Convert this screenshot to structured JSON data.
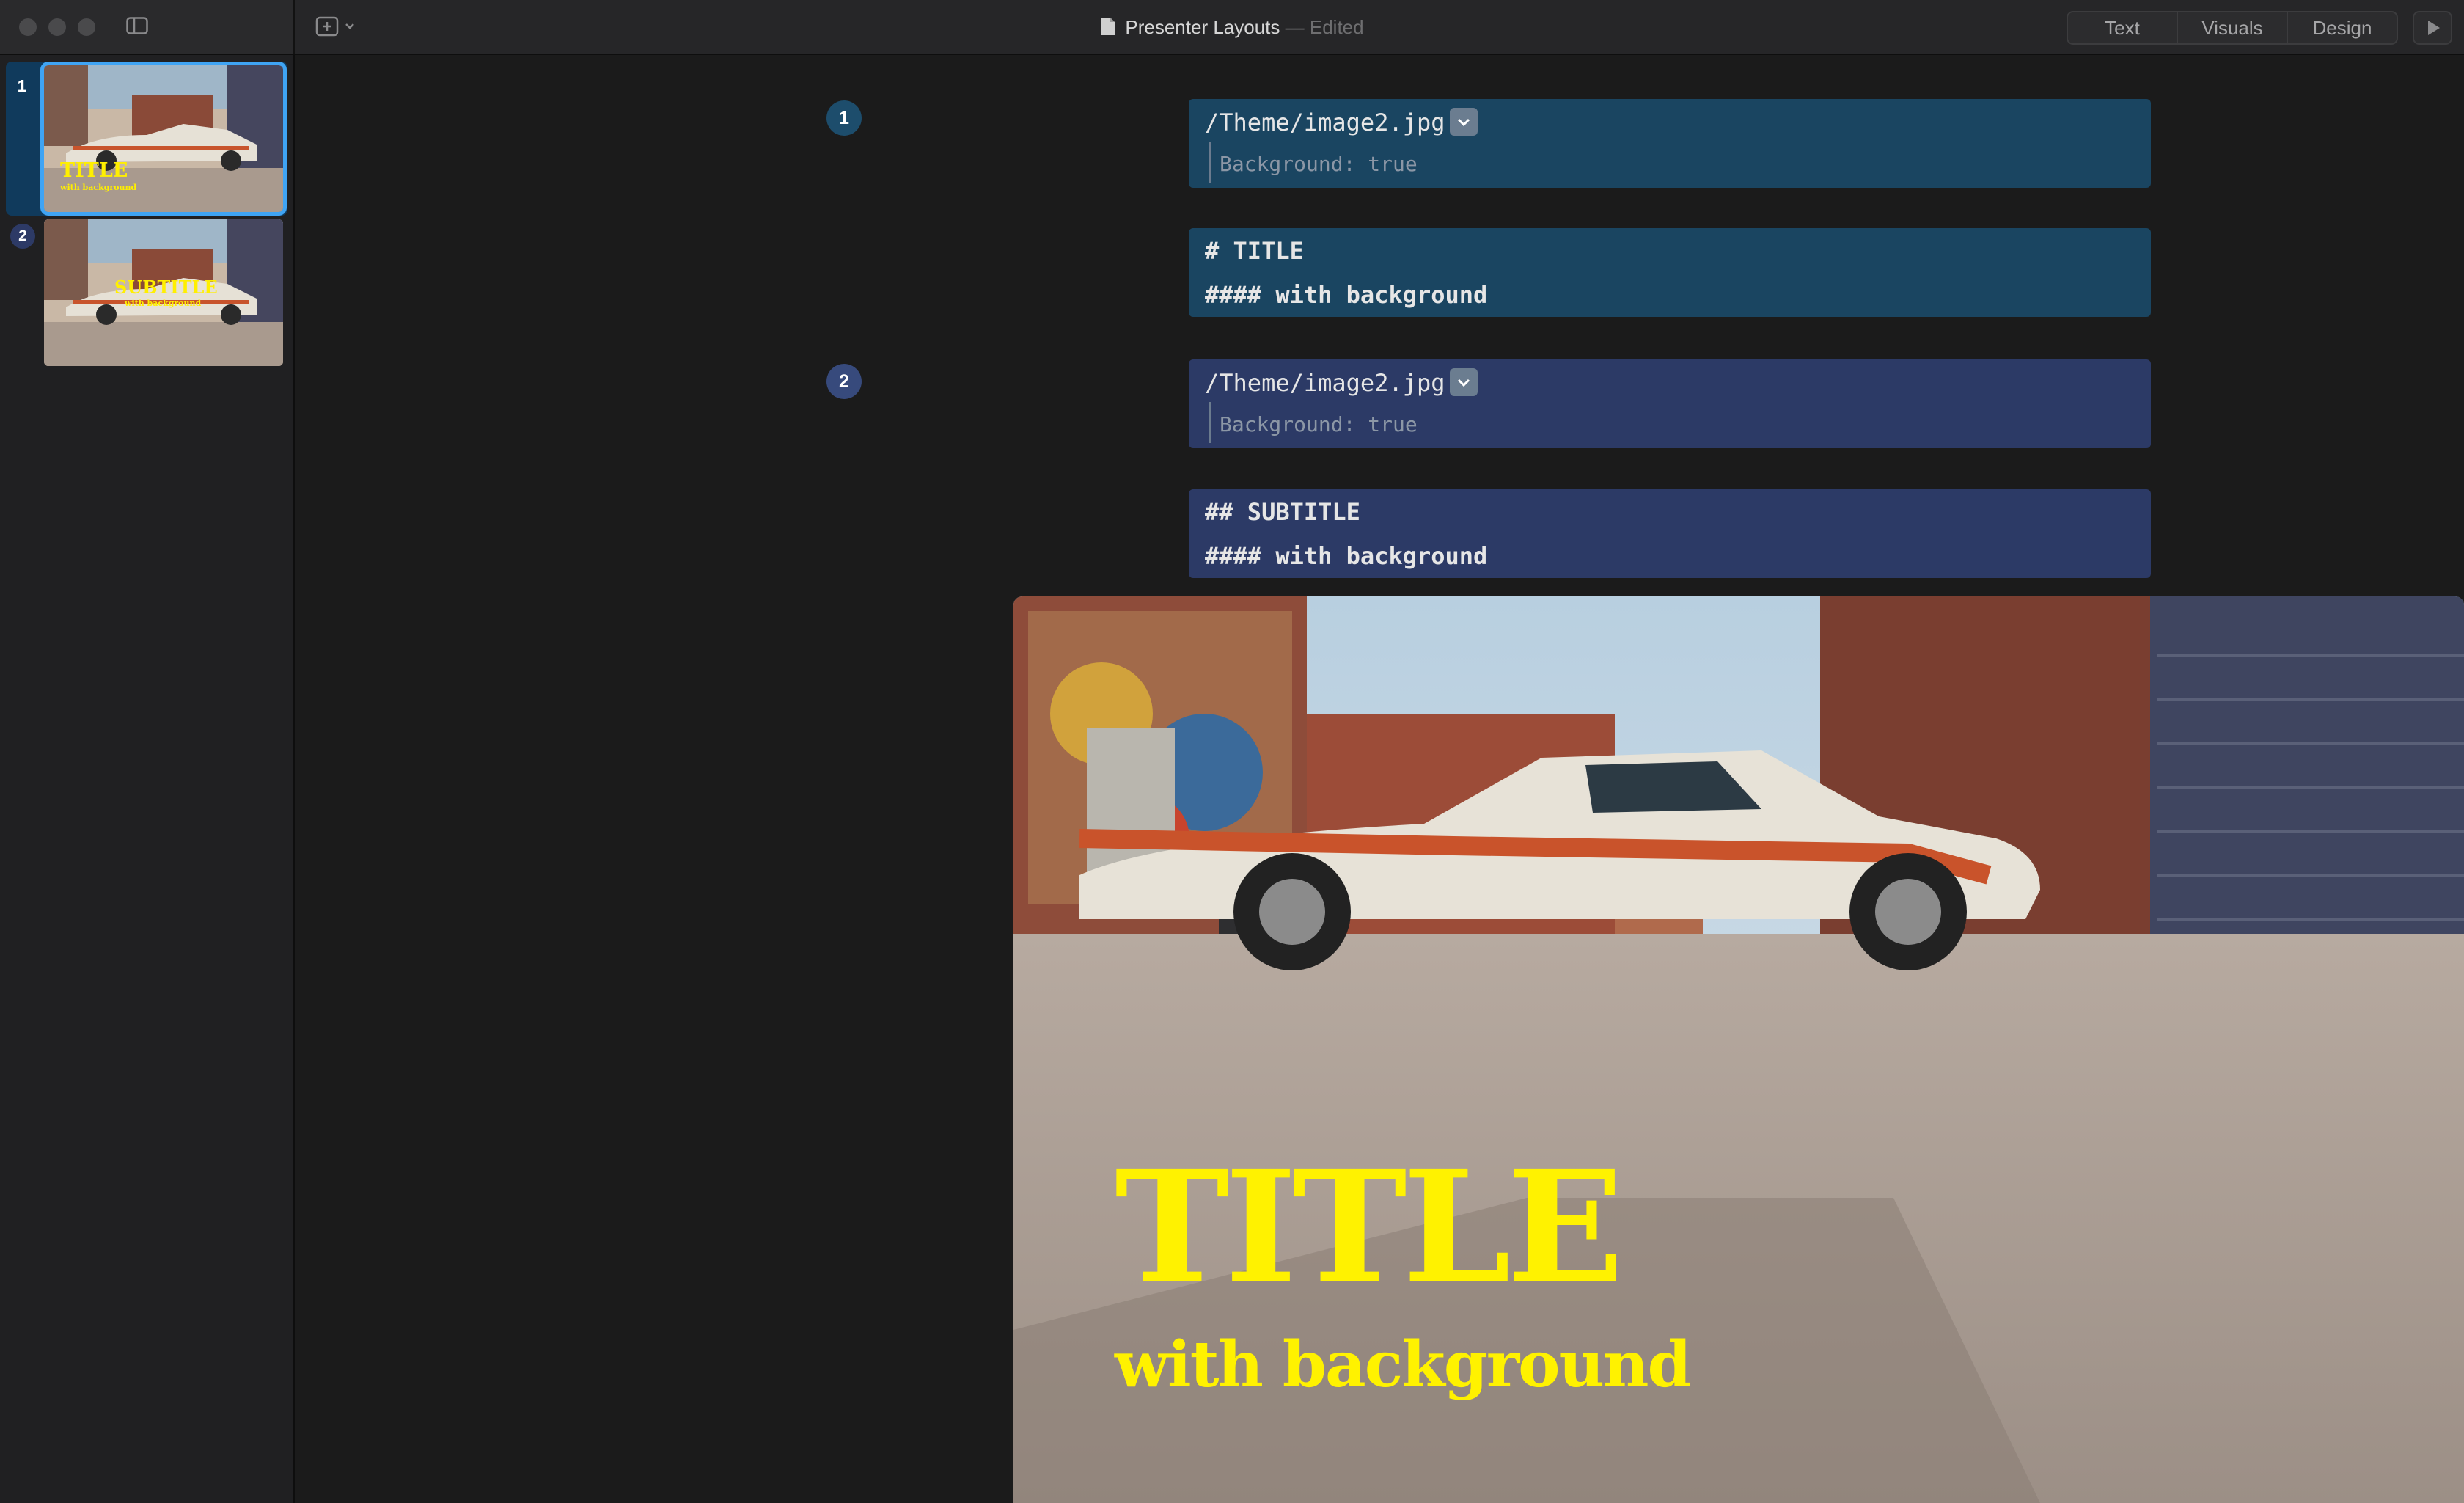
{
  "window": {
    "title": "Presenter Layouts",
    "title_separator": "—",
    "status": "Edited",
    "modes": [
      "Text",
      "Visuals",
      "Design"
    ]
  },
  "icons": {
    "traffic_lights": [
      "close-icon",
      "minimize-icon",
      "zoom-icon"
    ],
    "sidebar_toggle": "sidebar-toggle-icon",
    "add_slide": "plus-square-icon",
    "document": "document-icon",
    "play": "play-icon",
    "dropdown": "chevron-down-icon"
  },
  "sidebar": {
    "slides": [
      {
        "number": "1",
        "selected": true,
        "title": "TITLE",
        "subtitle": "with background"
      },
      {
        "number": "2",
        "selected": false,
        "title": "SUBTITLE",
        "subtitle": "with background"
      }
    ]
  },
  "editor": {
    "slides": [
      {
        "number": "1",
        "image_path": "/Theme/image2.jpg",
        "image_option": "Background: true",
        "heading": "# TITLE",
        "subheading": "#### with background"
      },
      {
        "number": "2",
        "image_path": "/Theme/image2.jpg",
        "image_option": "Background: true",
        "heading": "## SUBTITLE",
        "subheading": "#### with background"
      }
    ],
    "separator": "---"
  },
  "preview": {
    "title": "TITLE",
    "subtitle": "with background",
    "text_color": "#fff200"
  },
  "colors": {
    "accent": "#3fa4f4",
    "block_teal": "#1a4561",
    "block_navy": "#2c3a66"
  }
}
